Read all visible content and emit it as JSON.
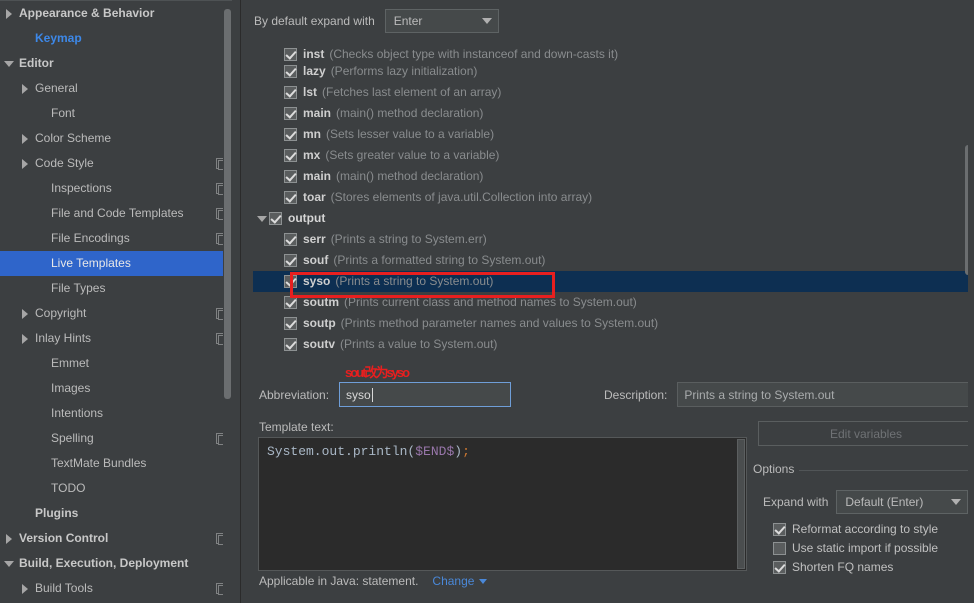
{
  "sidebar": {
    "items": [
      {
        "label": "Appearance & Behavior",
        "twisty": "collapsed",
        "depth": 0,
        "bold": true,
        "badge": false,
        "selected": false,
        "link": false
      },
      {
        "label": "Keymap",
        "twisty": "none",
        "depth": 1,
        "bold": false,
        "badge": false,
        "selected": false,
        "link": true
      },
      {
        "label": "Editor",
        "twisty": "expanded",
        "depth": 0,
        "bold": true,
        "badge": false,
        "selected": false,
        "link": false
      },
      {
        "label": "General",
        "twisty": "collapsed",
        "depth": 1,
        "bold": false,
        "badge": false,
        "selected": false,
        "link": false
      },
      {
        "label": "Font",
        "twisty": "none",
        "depth": 2,
        "bold": false,
        "badge": false,
        "selected": false,
        "link": false
      },
      {
        "label": "Color Scheme",
        "twisty": "collapsed",
        "depth": 1,
        "bold": false,
        "badge": false,
        "selected": false,
        "link": false
      },
      {
        "label": "Code Style",
        "twisty": "collapsed",
        "depth": 1,
        "bold": false,
        "badge": true,
        "selected": false,
        "link": false
      },
      {
        "label": "Inspections",
        "twisty": "none",
        "depth": 2,
        "bold": false,
        "badge": true,
        "selected": false,
        "link": false
      },
      {
        "label": "File and Code Templates",
        "twisty": "none",
        "depth": 2,
        "bold": false,
        "badge": true,
        "selected": false,
        "link": false
      },
      {
        "label": "File Encodings",
        "twisty": "none",
        "depth": 2,
        "bold": false,
        "badge": true,
        "selected": false,
        "link": false
      },
      {
        "label": "Live Templates",
        "twisty": "none",
        "depth": 2,
        "bold": false,
        "badge": false,
        "selected": true,
        "link": false
      },
      {
        "label": "File Types",
        "twisty": "none",
        "depth": 2,
        "bold": false,
        "badge": false,
        "selected": false,
        "link": false
      },
      {
        "label": "Copyright",
        "twisty": "collapsed",
        "depth": 1,
        "bold": false,
        "badge": true,
        "selected": false,
        "link": false
      },
      {
        "label": "Inlay Hints",
        "twisty": "collapsed",
        "depth": 1,
        "bold": false,
        "badge": true,
        "selected": false,
        "link": false
      },
      {
        "label": "Emmet",
        "twisty": "none",
        "depth": 2,
        "bold": false,
        "badge": false,
        "selected": false,
        "link": false
      },
      {
        "label": "Images",
        "twisty": "none",
        "depth": 2,
        "bold": false,
        "badge": false,
        "selected": false,
        "link": false
      },
      {
        "label": "Intentions",
        "twisty": "none",
        "depth": 2,
        "bold": false,
        "badge": false,
        "selected": false,
        "link": false
      },
      {
        "label": "Spelling",
        "twisty": "none",
        "depth": 2,
        "bold": false,
        "badge": true,
        "selected": false,
        "link": false
      },
      {
        "label": "TextMate Bundles",
        "twisty": "none",
        "depth": 2,
        "bold": false,
        "badge": false,
        "selected": false,
        "link": false
      },
      {
        "label": "TODO",
        "twisty": "none",
        "depth": 2,
        "bold": false,
        "badge": false,
        "selected": false,
        "link": false
      },
      {
        "label": "Plugins",
        "twisty": "none",
        "depth": 1,
        "bold": true,
        "badge": false,
        "selected": false,
        "link": false
      },
      {
        "label": "Version Control",
        "twisty": "collapsed",
        "depth": 0,
        "bold": true,
        "badge": true,
        "selected": false,
        "link": false
      },
      {
        "label": "Build, Execution, Deployment",
        "twisty": "expanded",
        "depth": 0,
        "bold": true,
        "badge": false,
        "selected": false,
        "link": false
      },
      {
        "label": "Build Tools",
        "twisty": "collapsed",
        "depth": 1,
        "bold": false,
        "badge": true,
        "selected": false,
        "link": false
      }
    ]
  },
  "topbar": {
    "label": "By default expand with",
    "expand_value": "Enter"
  },
  "templates": {
    "rows": [
      {
        "abbr": "inst",
        "desc": "(Checks object type with instanceof and down-casts it)",
        "checked": true,
        "indent": 2,
        "group": false,
        "selected": false,
        "clipped": true
      },
      {
        "abbr": "lazy",
        "desc": "(Performs lazy initialization)",
        "checked": true,
        "indent": 2,
        "group": false,
        "selected": false,
        "clipped": false
      },
      {
        "abbr": "lst",
        "desc": "(Fetches last element of an array)",
        "checked": true,
        "indent": 2,
        "group": false,
        "selected": false,
        "clipped": false
      },
      {
        "abbr": "main",
        "desc": "(main() method declaration)",
        "checked": true,
        "indent": 2,
        "group": false,
        "selected": false,
        "clipped": false
      },
      {
        "abbr": "mn",
        "desc": "(Sets lesser value to a variable)",
        "checked": true,
        "indent": 2,
        "group": false,
        "selected": false,
        "clipped": false
      },
      {
        "abbr": "mx",
        "desc": "(Sets greater value to a variable)",
        "checked": true,
        "indent": 2,
        "group": false,
        "selected": false,
        "clipped": false
      },
      {
        "abbr": "main",
        "desc": "(main() method declaration)",
        "checked": true,
        "indent": 2,
        "group": false,
        "selected": false,
        "clipped": false
      },
      {
        "abbr": "toar",
        "desc": "(Stores elements of java.util.Collection into array)",
        "checked": true,
        "indent": 2,
        "group": false,
        "selected": false,
        "clipped": false
      },
      {
        "abbr": "output",
        "desc": "",
        "checked": true,
        "indent": 0,
        "group": true,
        "selected": false,
        "clipped": false
      },
      {
        "abbr": "serr",
        "desc": "(Prints a string to System.err)",
        "checked": true,
        "indent": 2,
        "group": false,
        "selected": false,
        "clipped": false
      },
      {
        "abbr": "souf",
        "desc": "(Prints a formatted string to System.out)",
        "checked": true,
        "indent": 2,
        "group": false,
        "selected": false,
        "clipped": false
      },
      {
        "abbr": "syso",
        "desc": "(Prints a string to System.out)",
        "checked": true,
        "indent": 2,
        "group": false,
        "selected": true,
        "clipped": false
      },
      {
        "abbr": "soutm",
        "desc": "(Prints current class and method names to System.out)",
        "checked": true,
        "indent": 2,
        "group": false,
        "selected": false,
        "clipped": false
      },
      {
        "abbr": "soutp",
        "desc": "(Prints method parameter names and values to System.out)",
        "checked": true,
        "indent": 2,
        "group": false,
        "selected": false,
        "clipped": false
      },
      {
        "abbr": "soutv",
        "desc": "(Prints a value to System.out)",
        "checked": true,
        "indent": 2,
        "group": false,
        "selected": false,
        "clipped": false
      }
    ]
  },
  "annotation": {
    "note": "sout改为syso",
    "color": "#e81f1f"
  },
  "form": {
    "abbreviation_label": "Abbreviation:",
    "abbreviation_value": "syso",
    "description_label": "Description:",
    "description_value": "Prints a string to System.out",
    "template_text_label": "Template text:",
    "template_code_prefix": "System.out.println(",
    "template_code_var": "$END$",
    "template_code_close": ")",
    "template_code_semicolon": ";"
  },
  "options": {
    "edit_variables_label": "Edit variables",
    "legend": "Options",
    "expand_with_label": "Expand with",
    "expand_with_value": "Default (Enter)",
    "checkboxes": [
      {
        "label": "Reformat according to style",
        "checked": true
      },
      {
        "label": "Use static import if possible",
        "checked": false
      },
      {
        "label": "Shorten FQ names",
        "checked": true
      }
    ]
  },
  "footer": {
    "applicable_text": "Applicable in Java: statement.",
    "change_label": "Change"
  }
}
